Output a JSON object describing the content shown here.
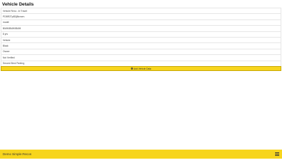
{
  "page": {
    "title": "Vehicle Details"
  },
  "vehicle_rows": [
    "Vehicle Reno - le Travel",
    "PDBR3Tp8Dj8kxnzrv",
    "model",
    "BMW/BMW/BMW",
    "8 yrs",
    "Vehicle",
    "Black",
    "Owner",
    "Not Verified",
    "Second Best Parking"
  ],
  "actions": {
    "add_vehicle_label": "Add Vehicle Data",
    "add_icon": "plus-circle-icon"
  },
  "footer": {
    "title": "Demo Simple Recon",
    "menu_icon": "grid-menu-icon"
  },
  "colors": {
    "accent": "#f7d51d",
    "border": "#e6e6e6",
    "text": "#444444"
  }
}
